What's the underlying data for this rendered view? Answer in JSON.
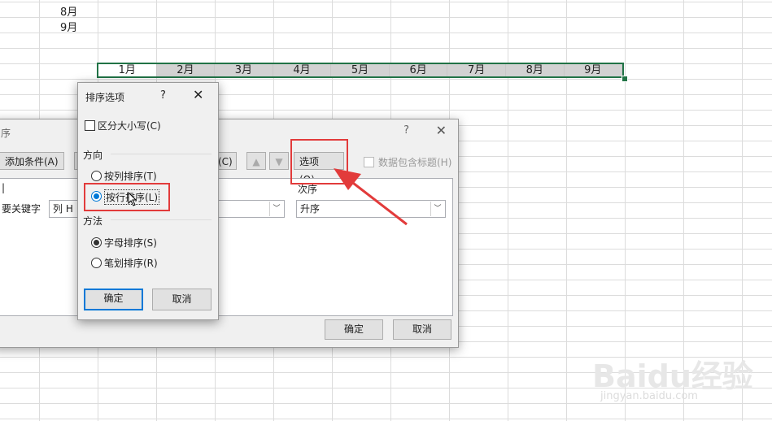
{
  "sheet": {
    "col_cells": [
      "8月",
      "9月"
    ],
    "row_cells": [
      "1月",
      "2月",
      "3月",
      "4月",
      "5月",
      "6月",
      "7月",
      "8月",
      "9月"
    ]
  },
  "sort_dialog": {
    "title": "序",
    "help": "?",
    "close": "✕",
    "add_level": "添加条件(A)",
    "copy_level": "(C)",
    "options_button": "选项(O)...",
    "has_headers": "数据包含标题(H)",
    "column_header": "|",
    "order_header": "次序",
    "primary_key_label": "要关键字",
    "column_value": "列 H",
    "order_value": "升序",
    "ok": "确定",
    "cancel": "取消"
  },
  "options_dialog": {
    "title": "排序选项",
    "help": "?",
    "close": "✕",
    "case_sensitive": "区分大小写(C)",
    "orientation_label": "方向",
    "sort_top_to_bottom": "按列排序(T)",
    "sort_left_to_right": "按行排序(L)",
    "method_label": "方法",
    "letter_sort": "字母排序(S)",
    "stroke_sort": "笔划排序(R)",
    "ok": "确定",
    "cancel": "取消"
  },
  "watermark": {
    "brand": "Baidu经验",
    "url": "jingyan.baidu.com"
  },
  "colors": {
    "annotation": "#e23b3b",
    "selection": "#217346",
    "focus": "#0078d7"
  }
}
